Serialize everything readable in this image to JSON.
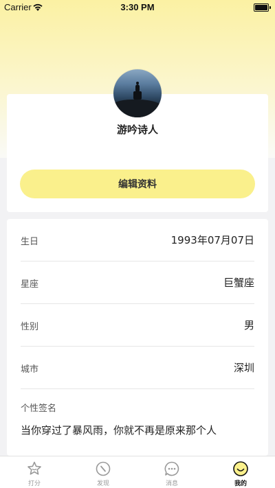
{
  "status_bar": {
    "carrier": "Carrier",
    "time": "3:30 PM"
  },
  "profile": {
    "username": "游吟诗人",
    "edit_button_label": "编辑资料"
  },
  "info": {
    "rows": [
      {
        "label": "生日",
        "value": "1993年07月07日"
      },
      {
        "label": "星座",
        "value": "巨蟹座"
      },
      {
        "label": "性别",
        "value": "男"
      },
      {
        "label": "城市",
        "value": "深圳"
      }
    ],
    "signature_label": "个性签名",
    "signature_text": "当你穿过了暴风雨，你就不再是原来那个人"
  },
  "tabbar": {
    "tabs": [
      {
        "label": "打分",
        "icon": "star-icon",
        "active": false
      },
      {
        "label": "发现",
        "icon": "compass-icon",
        "active": false
      },
      {
        "label": "消息",
        "icon": "chat-bubble-icon",
        "active": false
      },
      {
        "label": "我的",
        "icon": "smiley-face-icon",
        "active": true
      }
    ]
  },
  "colors": {
    "accent_yellow": "#faf08c",
    "header_gradient_top": "#fbf1a3",
    "background": "#f2f2f4"
  }
}
